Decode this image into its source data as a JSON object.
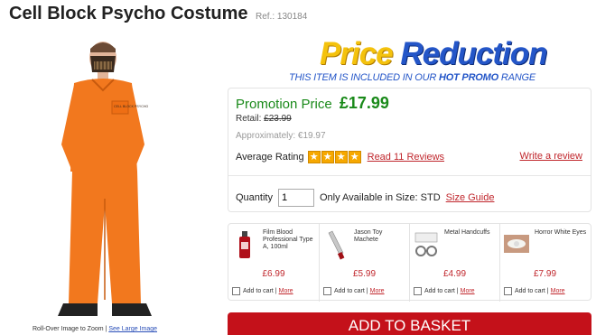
{
  "product": {
    "title": "Cell Block Psycho Costume",
    "ref": "Ref.: 130184",
    "image_caption": "Roll-Over Image to Zoom",
    "large_image_link": "See Large Image",
    "print_on_shirt": "CELL BLOCK PSYCHO"
  },
  "promo_banner": {
    "word1": "Price",
    "word2": "Reduction",
    "sub_prefix": "THIS ITEM IS INCLUDED IN OUR",
    "sub_bold": "HOT PROMO",
    "sub_suffix": "RANGE"
  },
  "pricing": {
    "promotion_label": "Promotion Price",
    "promotion_price": "£17.99",
    "retail_label": "Retail:",
    "retail_price": "£23.99",
    "approx": "Approximately: €19.97"
  },
  "rating": {
    "label": "Average Rating",
    "stars": 4,
    "read_reviews": "Read 11 Reviews",
    "write_review": "Write a review"
  },
  "quantity": {
    "label": "Quantity",
    "value": "1",
    "availability": "Only Available in Size: STD",
    "size_guide": "Size Guide"
  },
  "related": [
    {
      "name": "Film Blood Professional Type A, 100ml",
      "price": "£6.99",
      "add_to_cart": "Add to cart |",
      "more": "More",
      "icon": "blood-bottle-icon"
    },
    {
      "name": "Jason Toy Machete",
      "price": "£5.99",
      "add_to_cart": "Add to cart |",
      "more": "More",
      "icon": "machete-icon"
    },
    {
      "name": "Metal Handcuffs",
      "price": "£4.99",
      "add_to_cart": "Add to cart |",
      "more": "More",
      "icon": "handcuffs-icon"
    },
    {
      "name": "Horror White Eyes",
      "price": "£7.99",
      "add_to_cart": "Add to cart |",
      "more": "More",
      "icon": "eye-icon"
    }
  ],
  "basket": {
    "label": "ADD TO BASKET"
  },
  "colors": {
    "promo_green": "#1a8a1a",
    "link_red": "#c0262c",
    "basket_red": "#c4111a",
    "banner_yellow": "#f4c20d",
    "banner_blue": "#2456c8",
    "star_orange": "#f6a800"
  }
}
